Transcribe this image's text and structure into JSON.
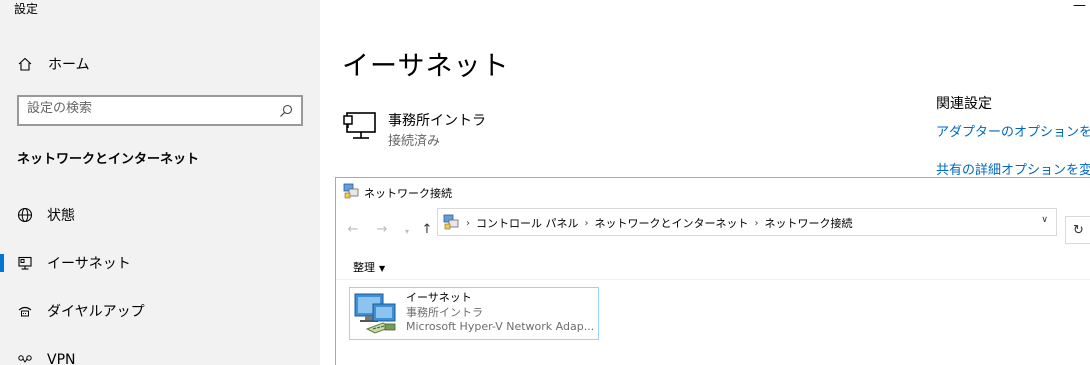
{
  "app_title": "設定",
  "sidebar": {
    "home_label": "ホーム",
    "search_placeholder": "設定の検索",
    "section_title": "ネットワークとインターネット",
    "items": [
      {
        "label": "状態",
        "icon": "globe-icon"
      },
      {
        "label": "イーサネット",
        "icon": "ethernet-icon",
        "active": true
      },
      {
        "label": "ダイヤルアップ",
        "icon": "dialup-icon"
      },
      {
        "label": "VPN",
        "icon": "vpn-icon"
      }
    ]
  },
  "main": {
    "page_title": "イーサネット",
    "network": {
      "name": "事務所イントラ",
      "status": "接続済み"
    },
    "related": {
      "title": "関連設定",
      "links": [
        "アダプターのオプションを変更",
        "共有の詳細オプションを変更"
      ]
    }
  },
  "netwin": {
    "title": "ネットワーク接続",
    "breadcrumbs": [
      "コントロール パネル",
      "ネットワークとインターネット",
      "ネットワーク接続"
    ],
    "organize_label": "整理",
    "item": {
      "name": "イーサネット",
      "network": "事務所イントラ",
      "adapter": "Microsoft Hyper-V Network Adap..."
    }
  },
  "colors": {
    "accent": "#0078d4",
    "link": "#0067c0",
    "sidebar_bg": "#f2f2f2",
    "selection_border": "#99d1ff"
  }
}
